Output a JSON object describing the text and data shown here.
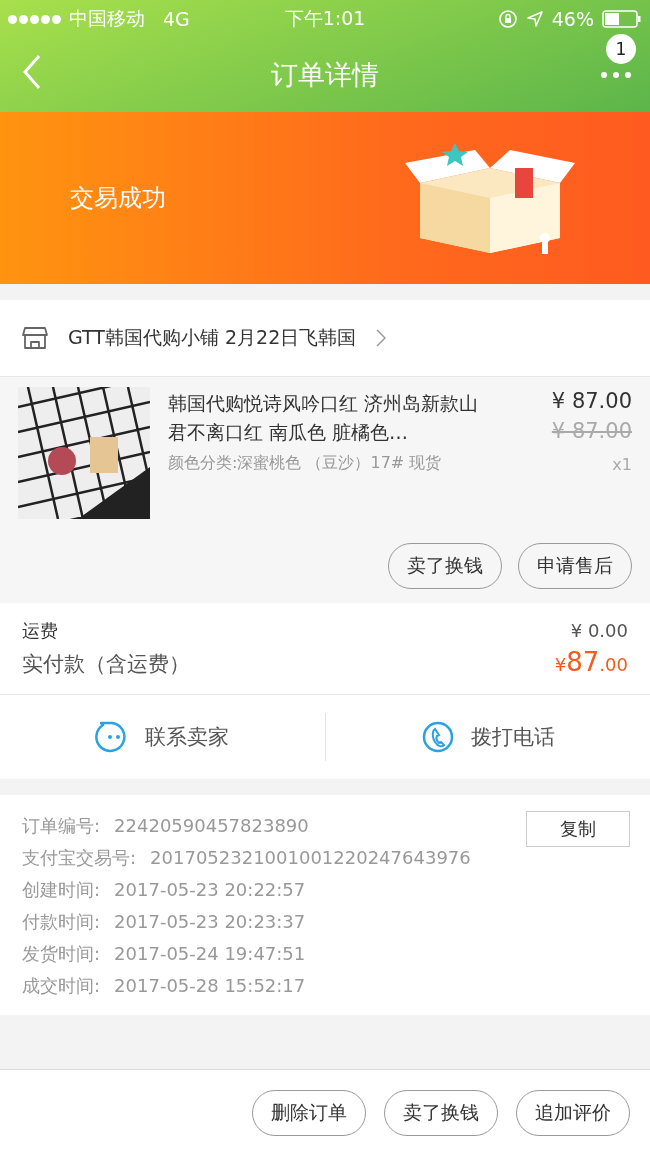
{
  "status_bar": {
    "carrier": "中国移动",
    "network": "4G",
    "time": "下午1:01",
    "battery": "46%"
  },
  "nav": {
    "title": "订单详情",
    "badge": "1"
  },
  "banner": {
    "status": "交易成功"
  },
  "shop": {
    "name": "GTT韩国代购小铺 2月22日飞韩国"
  },
  "item": {
    "title": "韩国代购悦诗风吟口红 济州岛新款山君不离口红 南瓜色 脏橘色…",
    "sku": "颜色分类:深蜜桃色 （豆沙）17# 现货",
    "price": "¥ 87.00",
    "original_price": "¥ 87.00",
    "quantity": "x1",
    "buttons": [
      "卖了换钱",
      "申请售后"
    ]
  },
  "fees": [
    {
      "label": "运费",
      "value": "¥ 0.00",
      "kind": "plain"
    },
    {
      "label": "实付款（含运费）",
      "currency": "¥",
      "value": "87",
      "decimals": ".00",
      "kind": "total"
    }
  ],
  "contact": [
    {
      "label": "联系卖家",
      "kind": "chat"
    },
    {
      "label": "拨打电话",
      "kind": "phone"
    }
  ],
  "info": {
    "copy_button": "复制",
    "rows": [
      {
        "label": "订单编号:",
        "value": "22420590457823890"
      },
      {
        "label": "支付宝交易号:",
        "value": "2017052321001001220247643976"
      },
      {
        "label": "创建时间:",
        "value": "2017-05-23 20:22:57"
      },
      {
        "label": "付款时间:",
        "value": "2017-05-23 20:23:37"
      },
      {
        "label": "发货时间:",
        "value": "2017-05-24 19:47:51"
      },
      {
        "label": "成交时间:",
        "value": "2017-05-28 15:52:17"
      }
    ]
  },
  "footer_buttons": [
    "删除订单",
    "卖了换钱",
    "追加评价"
  ]
}
